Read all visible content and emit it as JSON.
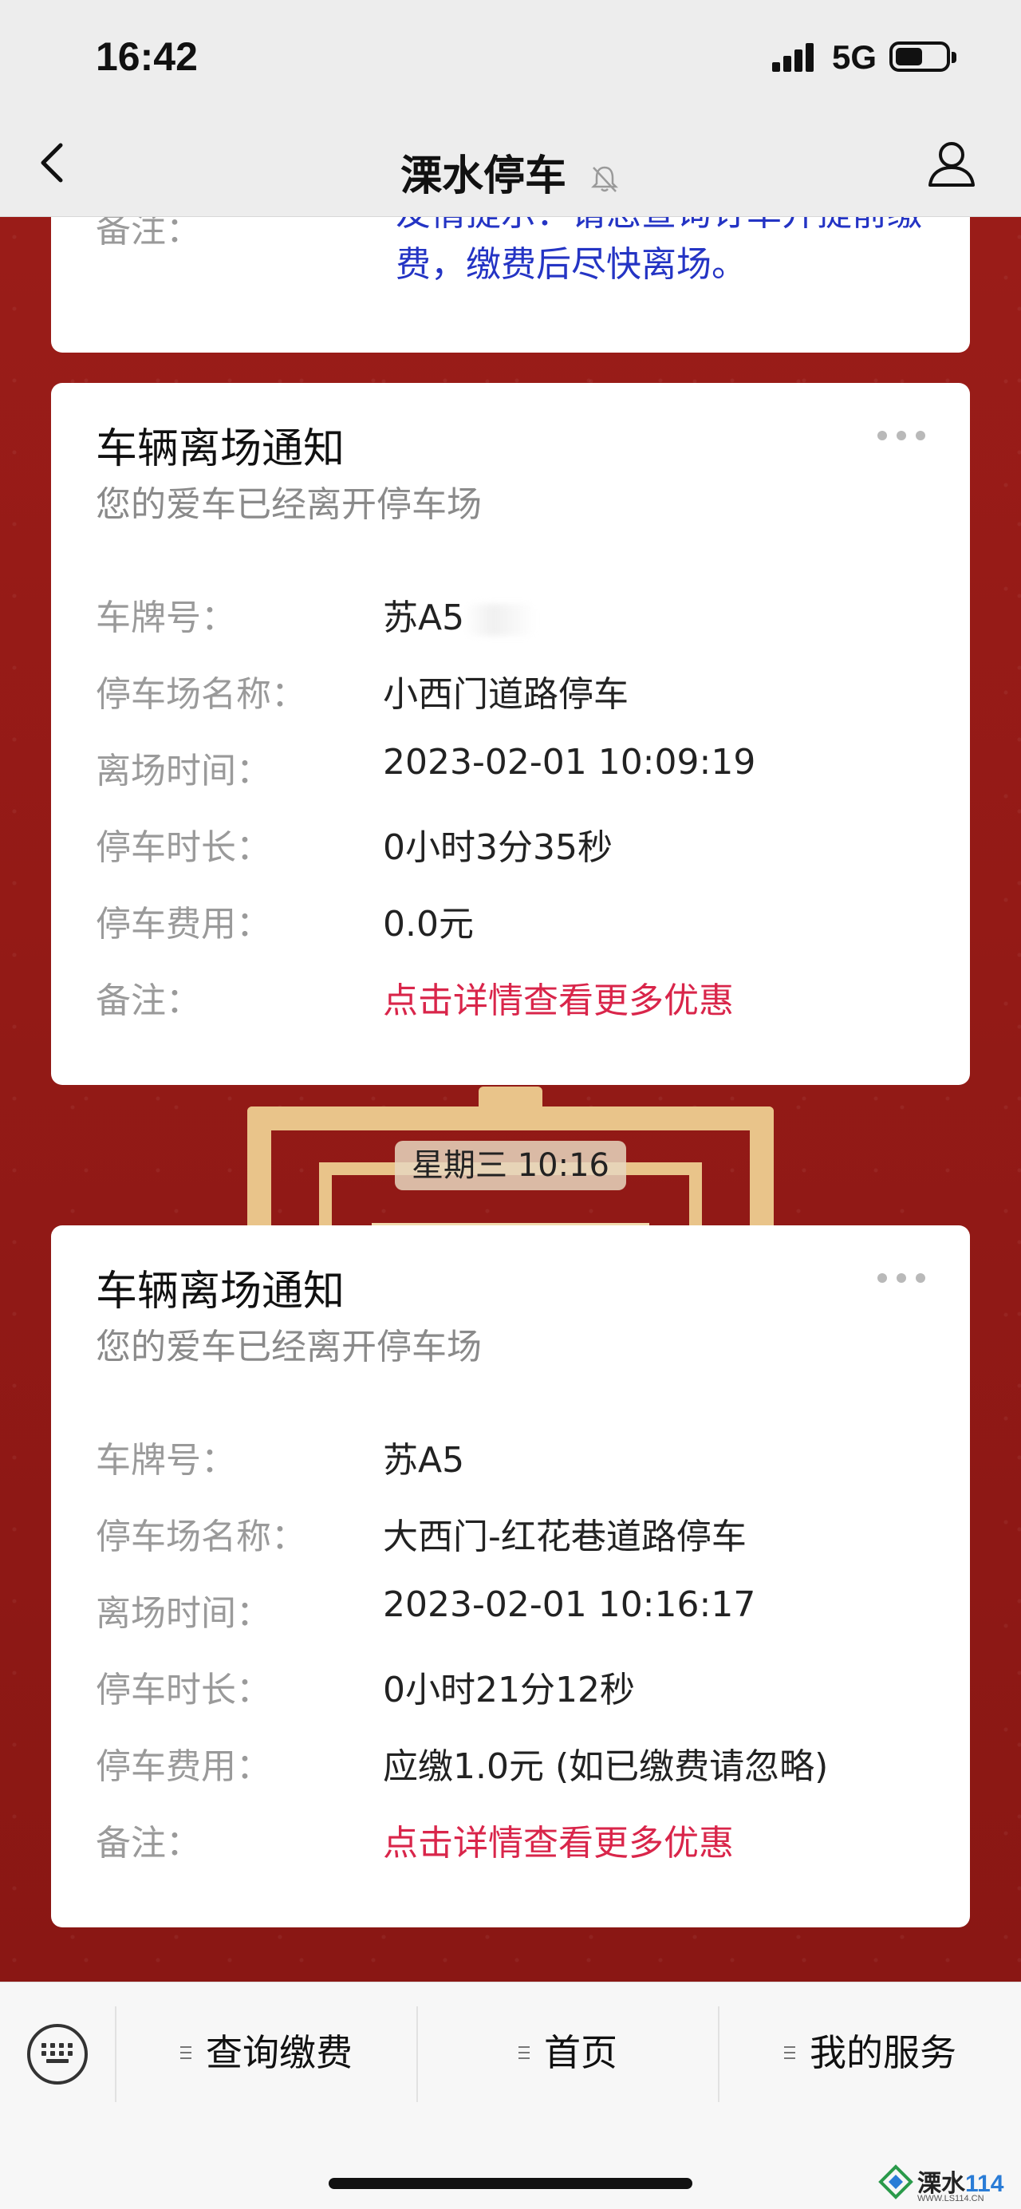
{
  "status_bar": {
    "time": "16:42",
    "network": "5G",
    "battery_level": 0.55
  },
  "nav": {
    "title": "溧水停车"
  },
  "partial_card": {
    "note_label": "备注：",
    "note_value": "友情提示：请您查询订单并提前缴费，缴费后尽快离场。"
  },
  "cards": [
    {
      "title": "车辆离场通知",
      "subtitle": "您的爱车已经离开停车场",
      "rows": [
        {
          "label": "车牌号：",
          "value": "苏A5"
        },
        {
          "label": "停车场名称：",
          "value": "小西门道路停车"
        },
        {
          "label": "离场时间：",
          "value": "2023-02-01 10:09:19"
        },
        {
          "label": "停车时长：",
          "value": "0小时3分35秒"
        },
        {
          "label": "停车费用：",
          "value": "0.0元"
        },
        {
          "label": "备注：",
          "value": "点击详情查看更多优惠"
        }
      ]
    },
    {
      "title": "车辆离场通知",
      "subtitle": "您的爱车已经离开停车场",
      "rows": [
        {
          "label": "车牌号：",
          "value": "苏A5"
        },
        {
          "label": "停车场名称：",
          "value": "大西门-红花巷道路停车"
        },
        {
          "label": "离场时间：",
          "value": "2023-02-01 10:16:17"
        },
        {
          "label": "停车时长：",
          "value": "0小时21分12秒"
        },
        {
          "label": "停车费用：",
          "value": "应缴1.0元 (如已缴费请忽略)"
        },
        {
          "label": "备注：",
          "value": "点击详情查看更多优惠"
        }
      ]
    }
  ],
  "timestamp": "星期三 10:16",
  "bottom_menu": {
    "items": [
      "查询缴费",
      "首页",
      "我的服务"
    ]
  },
  "watermark": {
    "brand": "溧水",
    "number": "114",
    "url": "WWW.LS114.CN"
  },
  "colors": {
    "accent_red": "#d9254a",
    "note_blue": "#2434c4",
    "background_red": "#8e1a17"
  }
}
